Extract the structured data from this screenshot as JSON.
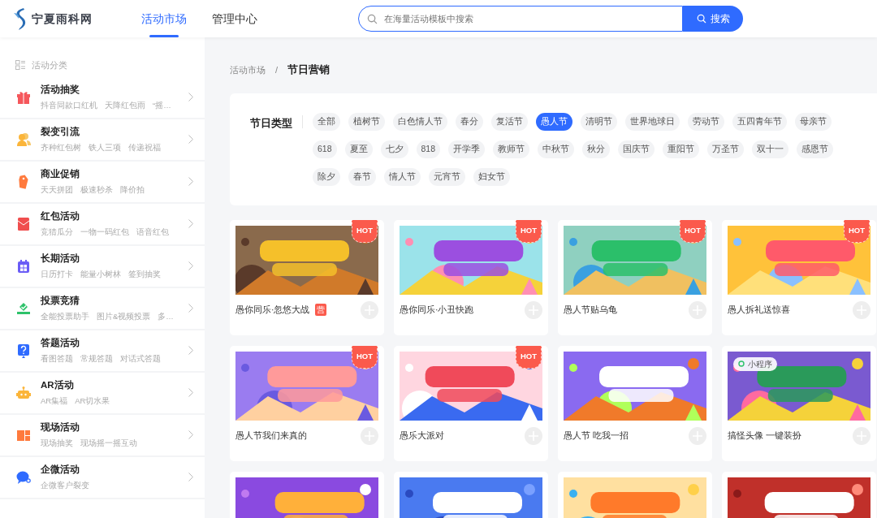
{
  "header": {
    "logo_text": "宁夏雨科网",
    "tabs": [
      {
        "label": "活动市场",
        "selected": true
      },
      {
        "label": "管理中心",
        "selected": false
      }
    ],
    "search": {
      "placeholder": "在海量活动模板中搜索",
      "button": "搜索"
    }
  },
  "sidebar": {
    "title": "活动分类",
    "items": [
      {
        "title": "活动抽奖",
        "tags": [
          "抖音同款口红机",
          "天降红包雨",
          "“摇…"
        ]
      },
      {
        "title": "裂变引流",
        "tags": [
          "齐种红包树",
          "铁人三项",
          "传递祝福"
        ]
      },
      {
        "title": "商业促销",
        "tags": [
          "天天拼团",
          "极速秒杀",
          "降价拍"
        ]
      },
      {
        "title": "红包活动",
        "tags": [
          "竞猜瓜分",
          "一物一码红包",
          "语音红包"
        ]
      },
      {
        "title": "长期活动",
        "tags": [
          "日历打卡",
          "能量小树林",
          "签到抽奖"
        ]
      },
      {
        "title": "投票竞猜",
        "tags": [
          "全能投票助手",
          "图片&视频投票",
          "多…"
        ]
      },
      {
        "title": "答题活动",
        "tags": [
          "看图答题",
          "常规答题",
          "对话式答题"
        ]
      },
      {
        "title": "AR活动",
        "tags": [
          "AR集福",
          "AR切水果"
        ]
      },
      {
        "title": "现场活动",
        "tags": [
          "现场抽奖",
          "现场摇一摇互动"
        ]
      },
      {
        "title": "企微活动",
        "tags": [
          "企微客户裂变"
        ]
      }
    ]
  },
  "breadcrumb": [
    "活动市场",
    "/",
    "节日营销"
  ],
  "filter": {
    "label": "节日类型",
    "chip_rows": [
      [
        {
          "label": "全部",
          "selected": false
        },
        {
          "label": "植树节",
          "selected": false
        },
        {
          "label": "白色情人节",
          "selected": false
        },
        {
          "label": "春分",
          "selected": false
        },
        {
          "label": "复活节",
          "selected": false
        },
        {
          "label": "愚人节",
          "selected": true
        },
        {
          "label": "清明节",
          "selected": false
        },
        {
          "label": "世界地球日",
          "selected": false
        },
        {
          "label": "劳动节",
          "selected": false
        },
        {
          "label": "五四青年节",
          "selected": false
        },
        {
          "label": "母亲节",
          "selected": false
        }
      ],
      [
        {
          "label": "618",
          "selected": false
        },
        {
          "label": "夏至",
          "selected": false
        },
        {
          "label": "七夕",
          "selected": false
        },
        {
          "label": "818",
          "selected": false
        },
        {
          "label": "开学季",
          "selected": false
        },
        {
          "label": "教师节",
          "selected": false
        },
        {
          "label": "中秋节",
          "selected": false
        },
        {
          "label": "秋分",
          "selected": false
        },
        {
          "label": "国庆节",
          "selected": false
        },
        {
          "label": "重阳节",
          "selected": false
        },
        {
          "label": "万圣节",
          "selected": false
        },
        {
          "label": "双十一",
          "selected": false
        },
        {
          "label": "感恩节",
          "selected": false
        }
      ],
      [
        {
          "label": "除夕",
          "selected": false
        },
        {
          "label": "春节",
          "selected": false
        },
        {
          "label": "情人节",
          "selected": false
        },
        {
          "label": "元宵节",
          "selected": false
        },
        {
          "label": "妇女节",
          "selected": false
        }
      ]
    ]
  },
  "templates": [
    {
      "kind": "picture",
      "title": "愚你同乐·忽悠大战",
      "badge": "HOT",
      "tag": "营"
    },
    {
      "kind": "picture",
      "title": "愚你同乐·小丑快跑",
      "badge": "HOT"
    },
    {
      "kind": "picture",
      "title": "愚人节贴乌龟",
      "badge": "HOT"
    },
    {
      "kind": "picture",
      "title": "愚人拆礼送惊喜",
      "badge": "HOT"
    },
    {
      "kind": "picture",
      "title": "愚人节我们来真的",
      "badge": "HOT"
    },
    {
      "kind": "picture",
      "title": "愚乐大派对",
      "badge": "HOT"
    },
    {
      "kind": "picture",
      "title": "愚人节 吃我一招"
    },
    {
      "kind": "picture",
      "title": "搞怪头像 一键装扮",
      "overlay": "小程序"
    },
    {
      "kind": "picture"
    },
    {
      "kind": "picture"
    },
    {
      "kind": "picture"
    },
    {
      "kind": "picture"
    }
  ]
}
